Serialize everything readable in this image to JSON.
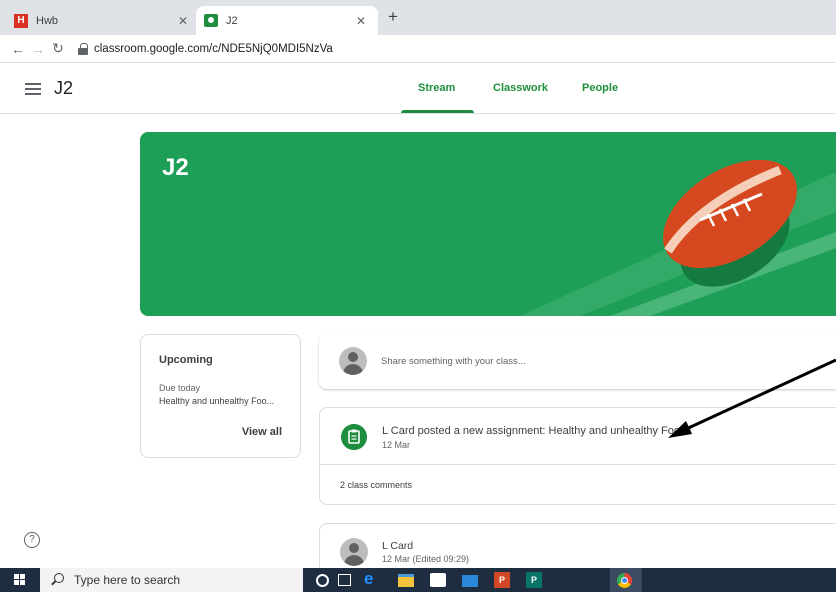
{
  "browser": {
    "tabs": [
      {
        "title": "Hwb",
        "favicon": "hwb-favicon",
        "active": false
      },
      {
        "title": "J2",
        "favicon": "classroom-favicon",
        "active": true
      }
    ],
    "url": "classroom.google.com/c/NDE5NjQ0MDI5NzVa"
  },
  "classroom": {
    "class_name": "J2",
    "nav": [
      {
        "label": "Stream",
        "active": true
      },
      {
        "label": "Classwork",
        "active": false
      },
      {
        "label": "People",
        "active": false
      }
    ],
    "banner_title": "J2",
    "accent_color": "#1e8e3e"
  },
  "upcoming": {
    "title": "Upcoming",
    "due_label": "Due today",
    "item": "Healthy and unhealthy Foo...",
    "view_all": "View all"
  },
  "share": {
    "placeholder": "Share something with your class..."
  },
  "assignment": {
    "title": "L Card posted a new assignment: Healthy and unhealthy Foods",
    "date": "12 Mar",
    "comments": "2 class comments"
  },
  "post": {
    "author": "L Card",
    "date": "12 Mar (Edited 09:29)"
  },
  "taskbar": {
    "search_placeholder": "Type here to search",
    "apps": [
      "cortana-icon",
      "task-view-icon",
      "edge-icon",
      "file-explorer-icon",
      "store-icon",
      "mail-icon",
      "powerpoint-icon",
      "publisher-icon",
      "chrome-icon"
    ]
  }
}
